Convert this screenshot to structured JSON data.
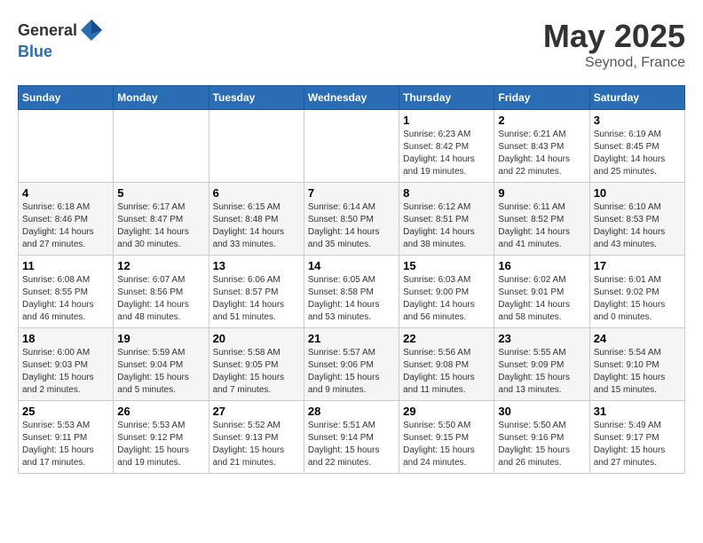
{
  "header": {
    "logo_general": "General",
    "logo_blue": "Blue",
    "month_year": "May 2025",
    "location": "Seynod, France"
  },
  "days_of_week": [
    "Sunday",
    "Monday",
    "Tuesday",
    "Wednesday",
    "Thursday",
    "Friday",
    "Saturday"
  ],
  "weeks": [
    [
      {
        "day": "",
        "info": ""
      },
      {
        "day": "",
        "info": ""
      },
      {
        "day": "",
        "info": ""
      },
      {
        "day": "",
        "info": ""
      },
      {
        "day": "1",
        "info": "Sunrise: 6:23 AM\nSunset: 8:42 PM\nDaylight: 14 hours\nand 19 minutes."
      },
      {
        "day": "2",
        "info": "Sunrise: 6:21 AM\nSunset: 8:43 PM\nDaylight: 14 hours\nand 22 minutes."
      },
      {
        "day": "3",
        "info": "Sunrise: 6:19 AM\nSunset: 8:45 PM\nDaylight: 14 hours\nand 25 minutes."
      }
    ],
    [
      {
        "day": "4",
        "info": "Sunrise: 6:18 AM\nSunset: 8:46 PM\nDaylight: 14 hours\nand 27 minutes."
      },
      {
        "day": "5",
        "info": "Sunrise: 6:17 AM\nSunset: 8:47 PM\nDaylight: 14 hours\nand 30 minutes."
      },
      {
        "day": "6",
        "info": "Sunrise: 6:15 AM\nSunset: 8:48 PM\nDaylight: 14 hours\nand 33 minutes."
      },
      {
        "day": "7",
        "info": "Sunrise: 6:14 AM\nSunset: 8:50 PM\nDaylight: 14 hours\nand 35 minutes."
      },
      {
        "day": "8",
        "info": "Sunrise: 6:12 AM\nSunset: 8:51 PM\nDaylight: 14 hours\nand 38 minutes."
      },
      {
        "day": "9",
        "info": "Sunrise: 6:11 AM\nSunset: 8:52 PM\nDaylight: 14 hours\nand 41 minutes."
      },
      {
        "day": "10",
        "info": "Sunrise: 6:10 AM\nSunset: 8:53 PM\nDaylight: 14 hours\nand 43 minutes."
      }
    ],
    [
      {
        "day": "11",
        "info": "Sunrise: 6:08 AM\nSunset: 8:55 PM\nDaylight: 14 hours\nand 46 minutes."
      },
      {
        "day": "12",
        "info": "Sunrise: 6:07 AM\nSunset: 8:56 PM\nDaylight: 14 hours\nand 48 minutes."
      },
      {
        "day": "13",
        "info": "Sunrise: 6:06 AM\nSunset: 8:57 PM\nDaylight: 14 hours\nand 51 minutes."
      },
      {
        "day": "14",
        "info": "Sunrise: 6:05 AM\nSunset: 8:58 PM\nDaylight: 14 hours\nand 53 minutes."
      },
      {
        "day": "15",
        "info": "Sunrise: 6:03 AM\nSunset: 9:00 PM\nDaylight: 14 hours\nand 56 minutes."
      },
      {
        "day": "16",
        "info": "Sunrise: 6:02 AM\nSunset: 9:01 PM\nDaylight: 14 hours\nand 58 minutes."
      },
      {
        "day": "17",
        "info": "Sunrise: 6:01 AM\nSunset: 9:02 PM\nDaylight: 15 hours\nand 0 minutes."
      }
    ],
    [
      {
        "day": "18",
        "info": "Sunrise: 6:00 AM\nSunset: 9:03 PM\nDaylight: 15 hours\nand 2 minutes."
      },
      {
        "day": "19",
        "info": "Sunrise: 5:59 AM\nSunset: 9:04 PM\nDaylight: 15 hours\nand 5 minutes."
      },
      {
        "day": "20",
        "info": "Sunrise: 5:58 AM\nSunset: 9:05 PM\nDaylight: 15 hours\nand 7 minutes."
      },
      {
        "day": "21",
        "info": "Sunrise: 5:57 AM\nSunset: 9:06 PM\nDaylight: 15 hours\nand 9 minutes."
      },
      {
        "day": "22",
        "info": "Sunrise: 5:56 AM\nSunset: 9:08 PM\nDaylight: 15 hours\nand 11 minutes."
      },
      {
        "day": "23",
        "info": "Sunrise: 5:55 AM\nSunset: 9:09 PM\nDaylight: 15 hours\nand 13 minutes."
      },
      {
        "day": "24",
        "info": "Sunrise: 5:54 AM\nSunset: 9:10 PM\nDaylight: 15 hours\nand 15 minutes."
      }
    ],
    [
      {
        "day": "25",
        "info": "Sunrise: 5:53 AM\nSunset: 9:11 PM\nDaylight: 15 hours\nand 17 minutes."
      },
      {
        "day": "26",
        "info": "Sunrise: 5:53 AM\nSunset: 9:12 PM\nDaylight: 15 hours\nand 19 minutes."
      },
      {
        "day": "27",
        "info": "Sunrise: 5:52 AM\nSunset: 9:13 PM\nDaylight: 15 hours\nand 21 minutes."
      },
      {
        "day": "28",
        "info": "Sunrise: 5:51 AM\nSunset: 9:14 PM\nDaylight: 15 hours\nand 22 minutes."
      },
      {
        "day": "29",
        "info": "Sunrise: 5:50 AM\nSunset: 9:15 PM\nDaylight: 15 hours\nand 24 minutes."
      },
      {
        "day": "30",
        "info": "Sunrise: 5:50 AM\nSunset: 9:16 PM\nDaylight: 15 hours\nand 26 minutes."
      },
      {
        "day": "31",
        "info": "Sunrise: 5:49 AM\nSunset: 9:17 PM\nDaylight: 15 hours\nand 27 minutes."
      }
    ]
  ]
}
